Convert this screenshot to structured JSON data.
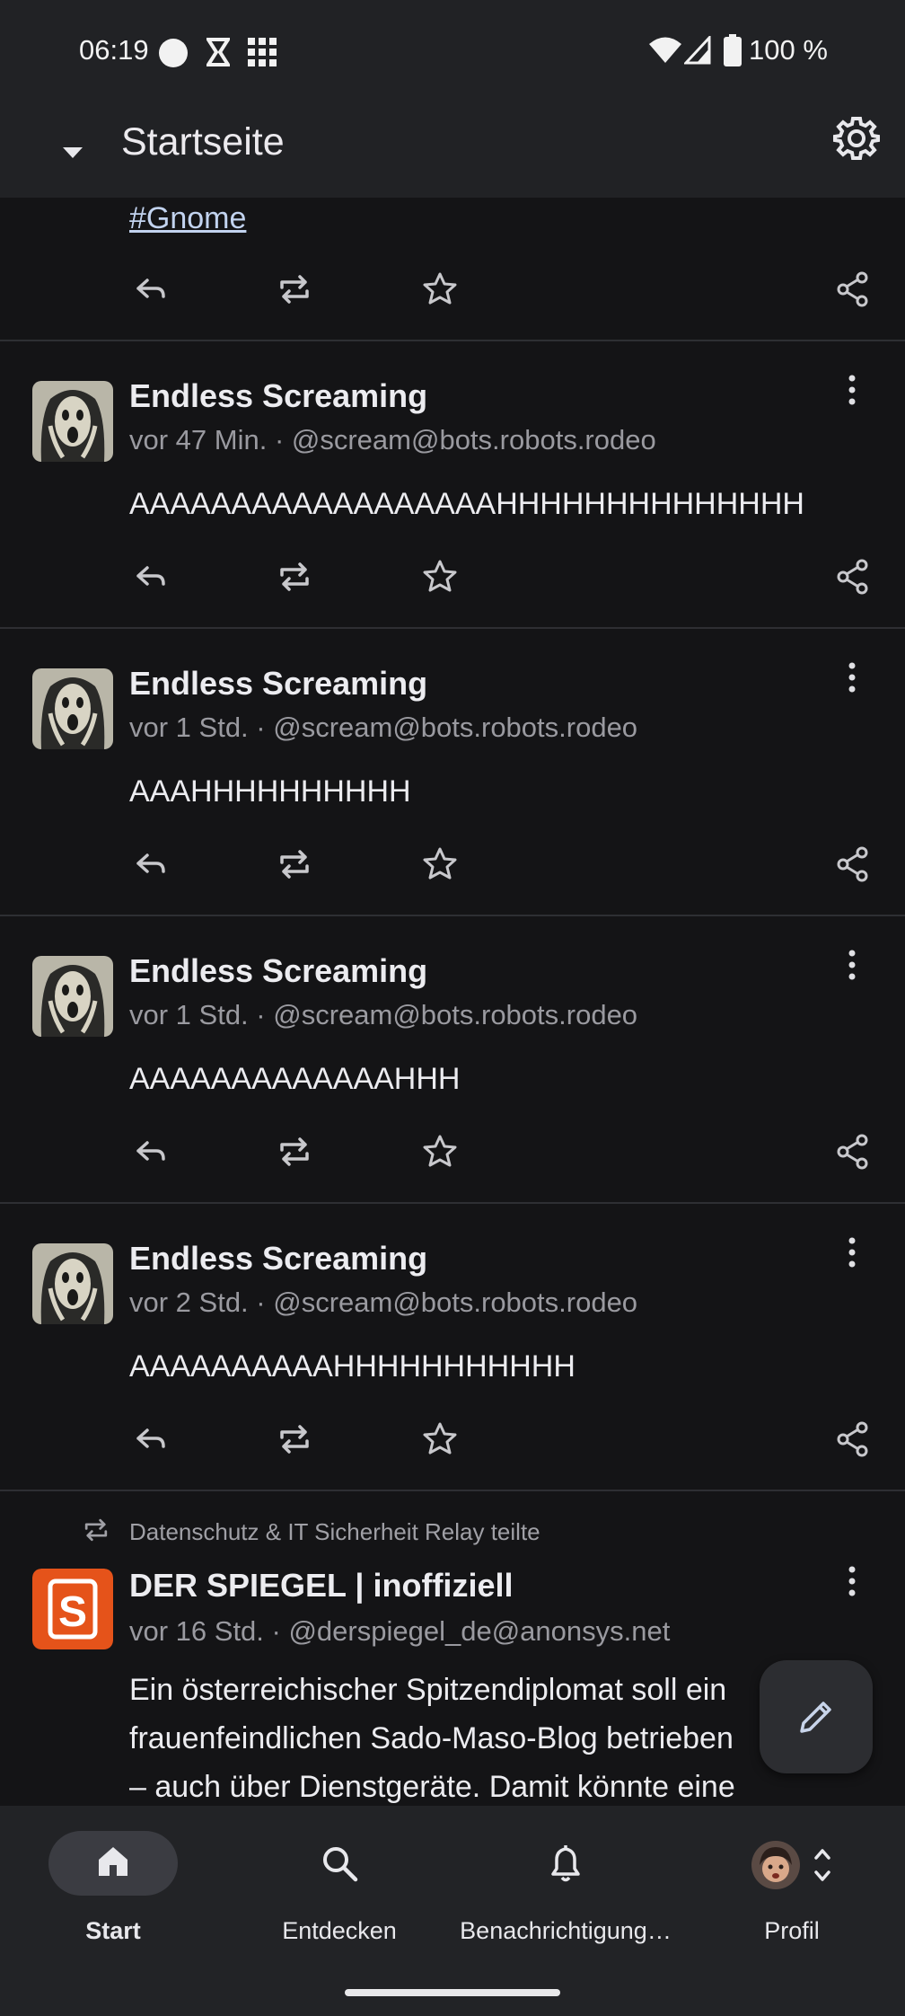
{
  "status_bar": {
    "time": "06:19",
    "battery": "100 %",
    "icons": [
      "circle-notification-icon",
      "hourglass-icon",
      "grid-app-icon",
      "wifi-icon",
      "signal-icon",
      "battery-icon"
    ]
  },
  "app_bar": {
    "title": "Startseite",
    "left_icon": "dropdown-arrow-icon",
    "right_icon": "gear-icon"
  },
  "partial_post": {
    "hashtag": "#Gnome"
  },
  "posts": [
    {
      "display_name": "Endless Screaming",
      "meta": "vor 47 Min. · @scream@bots.robots.rodeo",
      "content": "AAAAAAAAAAAAAAAAAAHHHHHHHHHHHHHH"
    },
    {
      "display_name": "Endless Screaming",
      "meta": "vor 1 Std. · @scream@bots.robots.rodeo",
      "content": "AAAHHHHHHHHHH"
    },
    {
      "display_name": "Endless Screaming",
      "meta": "vor 1 Std. · @scream@bots.robots.rodeo",
      "content": "AAAAAAAAAAAAAHHH"
    },
    {
      "display_name": "Endless Screaming",
      "meta": "vor 2 Std. · @scream@bots.robots.rodeo",
      "content": "AAAAAAAAAAHHHHHHHHHHH"
    }
  ],
  "boosted_post": {
    "boost_text": "Datenschutz & IT Sicherheit Relay teilte",
    "display_name": "DER SPIEGEL | inoffiziell",
    "meta": "vor 16 Std. · @derspiegel_de@anonsys.net",
    "content_lines": [
      "Ein österreichischer Spitzendiplomat soll ein",
      "frauenfeindlichen Sado-Maso-Blog betrieben",
      "– auch über Dienstgeräte. Damit könnte eine"
    ],
    "avatar_letter": "S",
    "avatar_color": "#e5531a"
  },
  "fab": {
    "icon": "pencil-icon"
  },
  "bottom_nav": {
    "items": [
      {
        "label": "Start",
        "icon": "home-icon",
        "active": true
      },
      {
        "label": "Entdecken",
        "icon": "search-icon",
        "active": false
      },
      {
        "label": "Benachrichtigung…",
        "icon": "bell-icon",
        "active": false
      },
      {
        "label": "Profil",
        "icon": "profile-avatar-icon",
        "active": false
      }
    ]
  },
  "colors": {
    "background": "#141416",
    "bar": "#212225",
    "link": "#c2d3ef",
    "muted_text": "#9a9aa0"
  }
}
